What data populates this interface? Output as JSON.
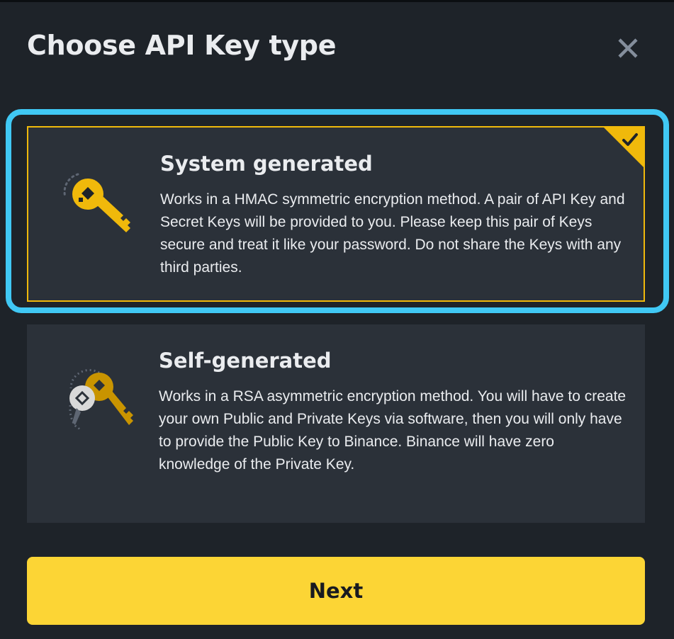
{
  "dialog": {
    "title": "Choose API Key type",
    "close_icon": "close-icon"
  },
  "options": [
    {
      "title": "System generated",
      "description": "Works in a HMAC symmetric encryption method. A pair of API Key and Secret Keys will be provided to you. Please keep this pair of Keys secure and treat it like your password. Do not share the Keys with any third parties.",
      "icon": "key-icon",
      "selected": true
    },
    {
      "title": "Self-generated",
      "description": "Works in a RSA asymmetric encryption method. You will have to create your own Public and Private Keys via software, then you will only have to provide the Public Key to Binance. Binance will have zero knowledge of the Private Key.",
      "icon": "key-pair-icon",
      "selected": false
    }
  ],
  "footer": {
    "next_label": "Next"
  },
  "colors": {
    "background": "#1e2329",
    "card": "#2b3139",
    "accent": "#f0b90b",
    "button": "#fcd535",
    "highlight": "#40c8f4",
    "text": "#eaecef"
  }
}
